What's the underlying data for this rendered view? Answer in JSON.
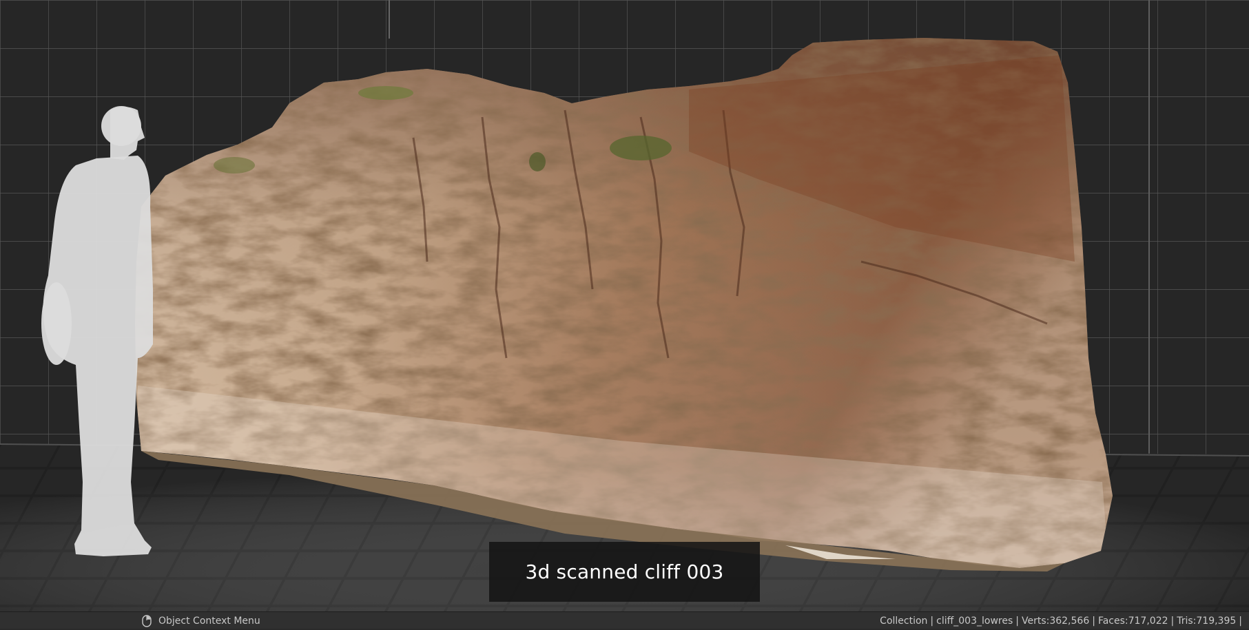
{
  "viewport": {
    "caption": "3d scanned cliff 003",
    "objects": [
      "human-scale-silhouette",
      "cliff-scan-mesh"
    ]
  },
  "statusbar": {
    "context_hint": "Object Context Menu",
    "hint_icon": "mouse-right-click-icon",
    "collection": "Collection",
    "object": "cliff_003_lowres",
    "verts": "Verts:362,566",
    "faces": "Faces:717,022",
    "tris": "Tris:719,395",
    "trailing_sep": "|"
  },
  "colors": {
    "background": "#262626",
    "grid_line": "#5a5a5a",
    "floor_tile": "#2e2e2e",
    "silhouette": "#d9d9d9",
    "rock_light": "#cdb39a",
    "rock_dark": "#7a4a30",
    "statusbar_bg": "#303030",
    "statusbar_text": "#c8c8c8"
  }
}
